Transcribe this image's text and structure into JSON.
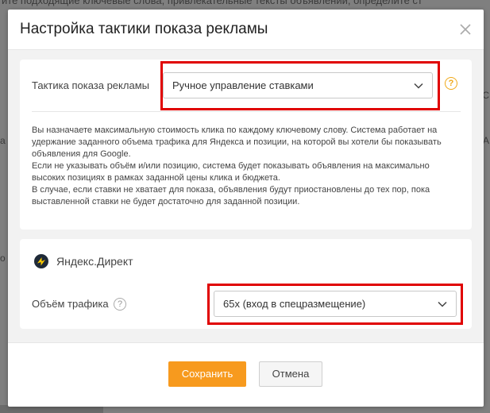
{
  "background": {
    "top_text": "ите подходящие ключевые слова, привлекательные тексты объявлений, определите ст",
    "left_fragments": [
      "а",
      "о"
    ],
    "right_fragments": [
      "С",
      "А"
    ]
  },
  "dialog": {
    "title": "Настройка тактики показа рекламы",
    "strategy": {
      "label": "Тактика показа рекламы",
      "selected": "Ручное управление ставками",
      "help": "?",
      "description": [
        "Вы назначаете максимальную стоимость клика по каждому ключевому слову. Система работает на",
        "удержание заданного объема трафика для Яндекса и позиции, на которой вы хотели бы показывать",
        "объявления для Google.",
        "Если не указывать объём и/или позицию, система будет показывать объявления на максимально",
        "высоких позициях в рамках заданной цены клика и бюджета.",
        "В случае, если ставки не хватает для показа, объявления будут приостановлены до тех пор, пока",
        "выставленной ставки не будет достаточно для заданной позиции."
      ]
    },
    "yandex": {
      "brand": "Яндекс.Директ",
      "traffic_label": "Объём трафика",
      "help": "?",
      "selected": "65х (вход в спецразмещение)"
    },
    "save_label": "Сохранить",
    "cancel_label": "Отмена"
  },
  "colors": {
    "accent": "#f79a1e",
    "highlight": "#e00000",
    "help_orange": "#f0a818"
  }
}
